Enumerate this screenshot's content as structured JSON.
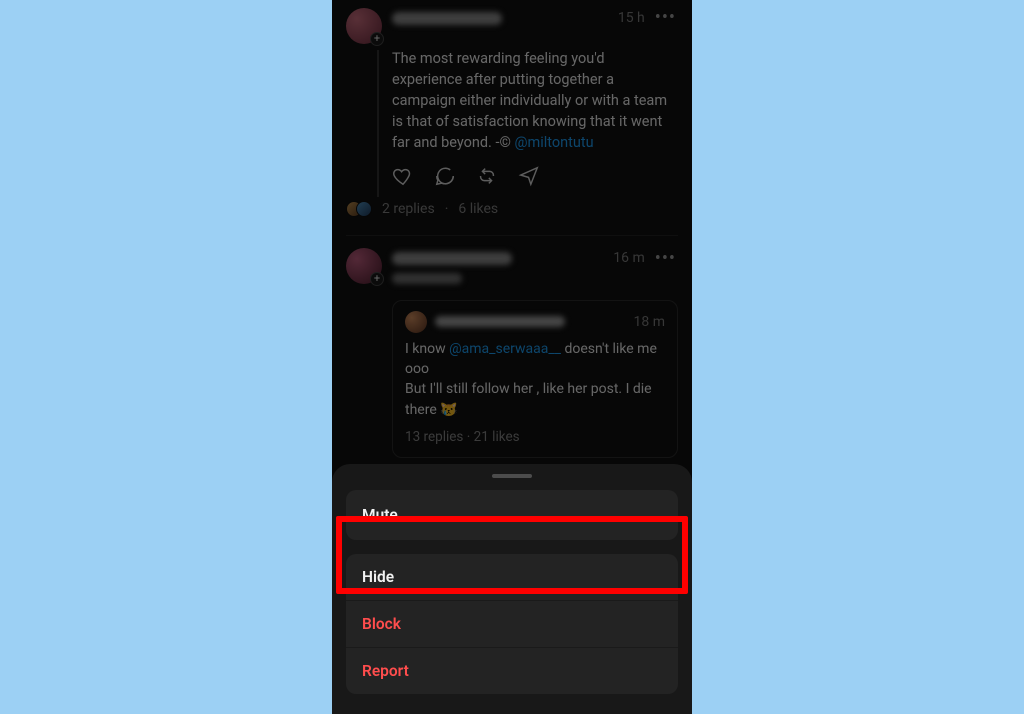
{
  "post1": {
    "time": "15 h",
    "body_pre": "The most rewarding feeling you'd experience after putting together a campaign either individually or with a team is that of satisfaction knowing that it went far and beyond. -© ",
    "mention": "@miltontutu",
    "replies": "2 replies",
    "sep": " · ",
    "likes": "6 likes"
  },
  "post2": {
    "time": "16 m",
    "quote": {
      "time": "18 m",
      "line1_pre": "I know ",
      "mention": "@ama_serwaaa__",
      "line1_post": " doesn't like me ooo",
      "line2": "But I'll still follow her , like her post. I die there 😿",
      "replies": "13 replies",
      "sep": " · ",
      "likes": "21 likes"
    }
  },
  "sheet": {
    "mute": "Mute",
    "hide": "Hide",
    "block": "Block",
    "report": "Report"
  }
}
